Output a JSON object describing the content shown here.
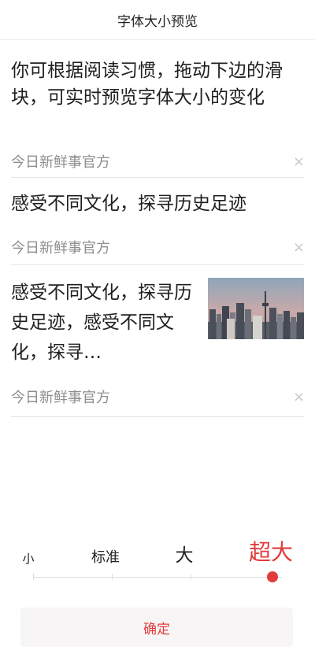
{
  "header": {
    "title": "字体大小预览"
  },
  "feed": {
    "items": [
      {
        "headline": "你可根据阅读习惯，拖动下边的滑块，可实时预览字体大小的变化",
        "source": "今日新鲜事官方",
        "close_glyph": "×"
      },
      {
        "headline": "感受不同文化，探寻历史足迹",
        "source": "今日新鲜事官方",
        "close_glyph": "×"
      },
      {
        "headline": "感受不同文化，探寻历史足迹，感受不同文化，探寻…",
        "source": "今日新鲜事官方",
        "close_glyph": "×",
        "thumbnail": "city-skyline-image"
      }
    ]
  },
  "font_size": {
    "options": [
      "小",
      "标准",
      "大",
      "超大"
    ],
    "selected_index": 3,
    "accent_color": "#e23b3b"
  },
  "footer": {
    "confirm_label": "确定"
  }
}
